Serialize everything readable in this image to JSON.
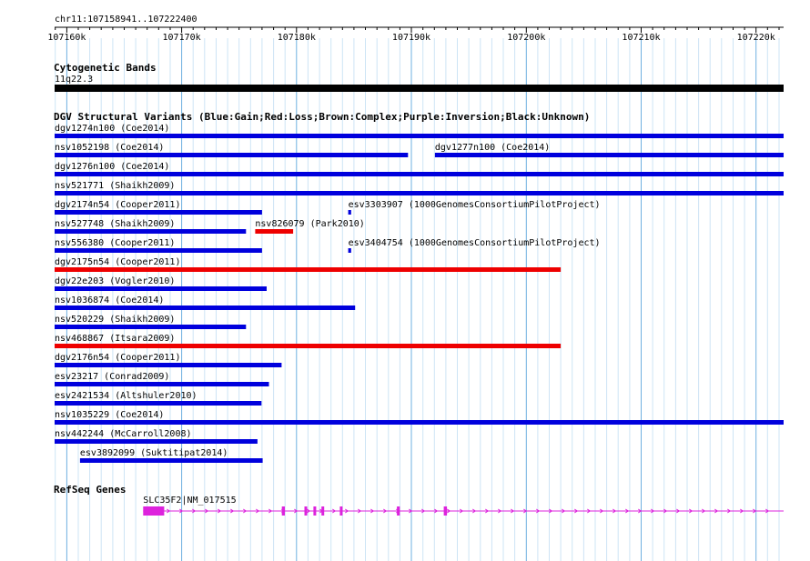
{
  "location": "chr11:107158941..107222400",
  "ruler": {
    "start": 107158941,
    "end": 107222400,
    "ticks": [
      {
        "pos": 107160000,
        "label": "107160k"
      },
      {
        "pos": 107170000,
        "label": "107170k"
      },
      {
        "pos": 107180000,
        "label": "107180k"
      },
      {
        "pos": 107190000,
        "label": "107190k"
      },
      {
        "pos": 107200000,
        "label": "107200k"
      },
      {
        "pos": 107210000,
        "label": "107210k"
      },
      {
        "pos": 107220000,
        "label": "107220k"
      }
    ]
  },
  "cytoband": {
    "title": "Cytogenetic Bands",
    "band": "11q22.3",
    "start": 107158941,
    "end": 107222400,
    "color": "#000000"
  },
  "dgv": {
    "title": "DGV Structural Variants (Blue:Gain;Red:Loss;Brown:Complex;Purple:Inversion;Black:Unknown)",
    "colors": {
      "gain": "#0000dd",
      "loss": "#ee0000"
    },
    "rows": [
      [
        {
          "label": "dgv1274n100 (Coe2014)",
          "type": "gain",
          "start": 107158941,
          "end": 107222400
        }
      ],
      [
        {
          "label": "nsv1052198 (Coe2014)",
          "type": "gain",
          "start": 107158941,
          "end": 107189700
        },
        {
          "label": "dgv1277n100 (Coe2014)",
          "type": "gain",
          "start": 107192050,
          "end": 107222400
        }
      ],
      [
        {
          "label": "dgv1276n100 (Coe2014)",
          "type": "gain",
          "start": 107158941,
          "end": 107222400
        }
      ],
      [
        {
          "label": "nsv521771 (Shaikh2009)",
          "type": "gain",
          "start": 107158941,
          "end": 107222400
        }
      ],
      [
        {
          "label": "dgv2174n54 (Cooper2011)",
          "type": "gain",
          "start": 107158941,
          "end": 107177000
        },
        {
          "label": "esv3303907 (1000GenomesConsortiumPilotProject)",
          "type": "gain",
          "start": 107184500,
          "end": 107184750
        }
      ],
      [
        {
          "label": "nsv527748 (Shaikh2009)",
          "type": "gain",
          "start": 107158941,
          "end": 107175600
        },
        {
          "label": "nsv826079 (Park2010)",
          "type": "loss",
          "start": 107176400,
          "end": 107179700
        }
      ],
      [
        {
          "label": "nsv556380 (Cooper2011)",
          "type": "gain",
          "start": 107158941,
          "end": 107177000
        },
        {
          "label": "esv3404754 (1000GenomesConsortiumPilotProject)",
          "type": "gain",
          "start": 107184500,
          "end": 107184750
        }
      ],
      [
        {
          "label": "dgv2175n54 (Cooper2011)",
          "type": "loss",
          "start": 107158941,
          "end": 107203000
        }
      ],
      [
        {
          "label": "dgv22e203 (Vogler2010)",
          "type": "gain",
          "start": 107158941,
          "end": 107177400
        }
      ],
      [
        {
          "label": "nsv1036874 (Coe2014)",
          "type": "gain",
          "start": 107158941,
          "end": 107185100
        }
      ],
      [
        {
          "label": "nsv520229 (Shaikh2009)",
          "type": "gain",
          "start": 107158941,
          "end": 107175600
        }
      ],
      [
        {
          "label": "nsv468867 (Itsara2009)",
          "type": "loss",
          "start": 107158941,
          "end": 107203000
        }
      ],
      [
        {
          "label": "dgv2176n54 (Cooper2011)",
          "type": "gain",
          "start": 107158941,
          "end": 107178700
        }
      ],
      [
        {
          "label": "esv23217 (Conrad2009)",
          "type": "gain",
          "start": 107158941,
          "end": 107177600
        }
      ],
      [
        {
          "label": "esv2421534 (Altshuler2010)",
          "type": "gain",
          "start": 107158941,
          "end": 107176950
        }
      ],
      [
        {
          "label": "nsv1035229 (Coe2014)",
          "type": "gain",
          "start": 107158941,
          "end": 107222400
        }
      ],
      [
        {
          "label": "nsv442244 (McCarroll2008)",
          "type": "gain",
          "start": 107158941,
          "end": 107176600
        }
      ],
      [
        {
          "label": "esv3892099 (Suktitipat2014)",
          "type": "gain",
          "start": 107161150,
          "end": 107177050
        }
      ]
    ]
  },
  "refseq": {
    "title": "RefSeq Genes",
    "gene": {
      "label": "SLC35F2|NM_017515",
      "color": "#dd22dd",
      "start": 107166650,
      "end": 107222400,
      "exons": [
        [
          107166650,
          107168480
        ],
        [
          107178720,
          107178980
        ],
        [
          107180690,
          107180880
        ],
        [
          107181470,
          107181650
        ],
        [
          107182170,
          107182380
        ],
        [
          107183770,
          107184000
        ],
        [
          107188740,
          107188990
        ],
        [
          107192820,
          107193100
        ]
      ]
    }
  }
}
